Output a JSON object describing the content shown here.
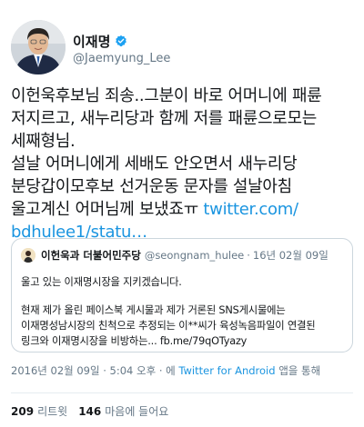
{
  "author": {
    "display_name": "이재명",
    "handle": "@Jaemyung_Lee",
    "verified": true,
    "avatar_icon": "profile-photo",
    "verified_icon": "verified-badge-icon"
  },
  "tweet": {
    "lines": [
      "이헌욱후보님 죄송..그분이 바로 어머니에 패륜",
      "저지르고, 새누리당과 함께 저를 패륜으로모는",
      "세째형님.",
      "설날 어머니에게 세배도 안오면서 새누리당",
      "분당갑이모후보 선거운동 문자를 설날아침",
      "울고계신 어머님께 보냈죠ㅠ"
    ],
    "link_inline": "twitter.com/",
    "link_continued": "bdhulee1/statu…"
  },
  "quote": {
    "name": "이헌욱과 더불어민주당",
    "handle": "@seongnam_hulee",
    "separator": "·",
    "date": "16년 02월 09일",
    "line1": "울고 있는 이재명시장을 지키겠습니다.",
    "body_lines": [
      "현재 제가 올린 페이스북 게시물과 제가 거론된 SNS게시물에는",
      "이재명성남시장의 친척으로 추정되는 이**씨가 육성녹음파일이 연결된",
      "링크와 이재명시장을 비방하는... fb.me/79qOTyazy"
    ]
  },
  "meta": {
    "timestamp": "2016년 02월 09일 · 5:04 오후 · 에",
    "source": "Twitter for Android",
    "via_suffix": "앱을 통해"
  },
  "stats": {
    "retweets_count": "209",
    "retweets_label": "리트윗",
    "likes_count": "146",
    "likes_label": "마음에 들어요"
  },
  "colors": {
    "link": "#1b95e0",
    "secondary_text": "#657786",
    "primary_text": "#14171a",
    "verified_badge": "#1da1f2",
    "border": "#ccd6dd"
  }
}
